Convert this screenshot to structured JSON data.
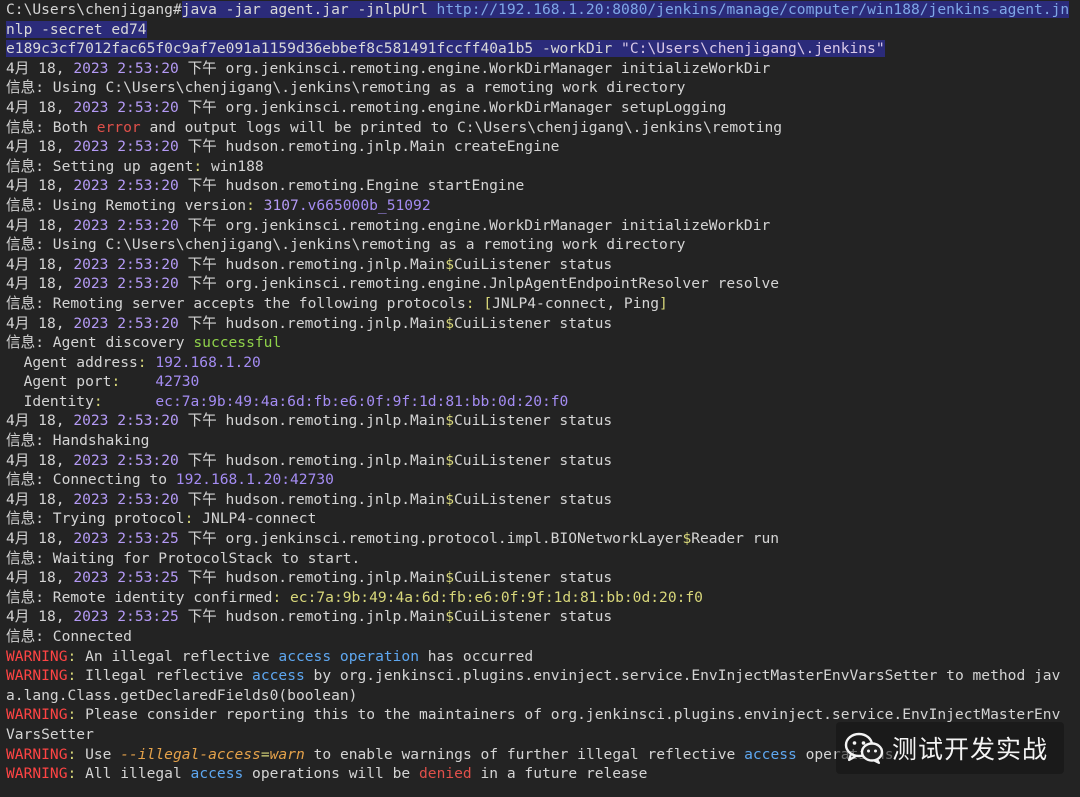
{
  "prompt": "C:\\Users\\chenjigang",
  "prompt_sep": "#",
  "cmd": {
    "p1": "java -jar agent.jar -jnlpUrl ",
    "url": "http://192.168.1.20:8080/jenkins/manage/computer/win188/jenkins-agent.jn",
    "p2": "nlp -secret ed74",
    "p3": "e189c3cf7012fac65f0c9af7e091a1159d36ebbef8c581491fccff40a1b5 -workDir ",
    "workdir": "\"C:\\Users\\chenjigang\\.jenkins\""
  },
  "log_prefix": "4月 18, ",
  "log_year": "2023",
  "pm": " 下午 ",
  "info": "信息:",
  "warning": "WARNING",
  "lines": [
    {
      "time": "2:53:20",
      "cls": "org.jenkinsci.remoting.engine.WorkDirManager initializeWorkDir"
    },
    {
      "msg": "Using C:\\Users\\chenjigang\\.jenkins\\remoting as a remoting work directory"
    },
    {
      "time": "2:53:20",
      "cls": "org.jenkinsci.remoting.engine.WorkDirManager setupLogging"
    },
    {
      "msg_a": "Both ",
      "msg_err": "error",
      "msg_b": " and output logs will be printed to C:\\Users\\chenjigang\\.jenkins\\remoting"
    },
    {
      "time": "2:53:20",
      "cls": "hudson.remoting.jnlp.Main createEngine"
    },
    {
      "msg": "Setting up agent",
      "msg_colon": ":",
      "msg_tail": " win188"
    },
    {
      "time": "2:53:20",
      "cls": "hudson.remoting.Engine startEngine"
    },
    {
      "msg": "Using Remoting version",
      "msg_colon": ":",
      "ver_num": "3107",
      "ver_tail": ".v665000b_51092"
    },
    {
      "time": "2:53:20",
      "cls": "org.jenkinsci.remoting.engine.WorkDirManager initializeWorkDir"
    },
    {
      "msg": "Using C:\\Users\\chenjigang\\.jenkins\\remoting as a remoting work directory"
    },
    {
      "time": "2:53:20",
      "cls_a": "hudson.remoting.jnlp.Main",
      "cls_d": "$",
      "cls_b": "CuiListener status"
    },
    {
      "time": "2:53:20",
      "cls": "org.jenkinsci.remoting.engine.JnlpAgentEndpointResolver resolve"
    },
    {
      "msg": "Remoting server accepts the following protocols",
      "msg_colon": ":",
      "proto_open": " [",
      "proto": "JNLP4-connect, Ping",
      "proto_close": "]"
    },
    {
      "time": "2:53:20",
      "cls_a": "hudson.remoting.jnlp.Main",
      "cls_d": "$",
      "cls_b": "CuiListener status"
    },
    {
      "msg": "Agent discovery ",
      "ok": "successful"
    },
    {
      "detail_label": "  Agent address",
      "detail_colon": ":",
      "detail_value": " 192.168.1.20"
    },
    {
      "detail_label": "  Agent port",
      "detail_colon": ":",
      "detail_value": "    42730"
    },
    {
      "detail_label": "  Identity",
      "detail_colon": ":",
      "detail_value": "      ec:7a:9b:49:4a:6d:fb:e6:0f:9f:1d:81:bb:0d:20:f0"
    },
    {
      "time": "2:53:20",
      "cls_a": "hudson.remoting.jnlp.Main",
      "cls_d": "$",
      "cls_b": "CuiListener status"
    },
    {
      "msg": "Handshaking"
    },
    {
      "time": "2:53:20",
      "cls_a": "hudson.remoting.jnlp.Main",
      "cls_d": "$",
      "cls_b": "CuiListener status"
    },
    {
      "msg": "Connecting to ",
      "host": "192.168.1.20:42730"
    },
    {
      "time": "2:53:20",
      "cls_a": "hudson.remoting.jnlp.Main",
      "cls_d": "$",
      "cls_b": "CuiListener status"
    },
    {
      "msg": "Trying protocol",
      "msg_colon": ":",
      "msg_tail": " JNLP4-connect"
    },
    {
      "time": "2:53:25",
      "cls_a": "org.jenkinsci.remoting.protocol.impl.BIONetworkLayer",
      "cls_d": "$",
      "cls_b": "Reader run"
    },
    {
      "msg": "Waiting for ProtocolStack to start."
    },
    {
      "time": "2:53:25",
      "cls_a": "hudson.remoting.jnlp.Main",
      "cls_d": "$",
      "cls_b": "CuiListener status"
    },
    {
      "msg": "Remote identity confirmed",
      "msg_colon": ":",
      "ident": " ec:7a:9b:49:4a:6d:fb:e6:0f:9f:1d:81:bb:0d:20:f0"
    },
    {
      "time": "2:53:25",
      "cls_a": "hudson.remoting.jnlp.Main",
      "cls_d": "$",
      "cls_b": "CuiListener status"
    },
    {
      "msg": "Connected"
    }
  ],
  "warnings": {
    "w1_a": " An illegal reflective ",
    "w1_acc": "access",
    "w1_sp": " ",
    "w1_op": "operation",
    "w1_b": " has occurred",
    "w2_a": " Illegal reflective ",
    "w2_acc": "access",
    "w2_b": " by org.jenkinsci.plugins.envinject.service.EnvInjectMasterEnvVarsSetter to method jav",
    "w2_c": "a.lang.Class.getDeclaredFields0(boolean)",
    "w3_a": " Please consider reporting this to the maintainers of org.jenkinsci.plugins.envinject.service.EnvInjectMasterEnv",
    "w3_b": "VarsSetter",
    "w4_a": " Use ",
    "w4_flag": "--illegal-access",
    "w4_eq": "=",
    "w4_val": "warn",
    "w4_b": " to enable warnings of further illegal reflective ",
    "w4_acc": "access",
    "w4_c": " operations",
    "w5_a": " All illegal ",
    "w5_acc": "access",
    "w5_b": " operations will be ",
    "w5_den": "denied",
    "w5_c": " in a future release"
  },
  "watermark": "测试开发实战",
  "colors": {
    "background": "#232323",
    "selection": "#2b2b7a",
    "number": "#b49af5",
    "error": "#e0504a",
    "yellow": "#d8d77a",
    "green": "#8fd24a",
    "blue": "#5ea7f0",
    "warning": "#ff4444"
  }
}
